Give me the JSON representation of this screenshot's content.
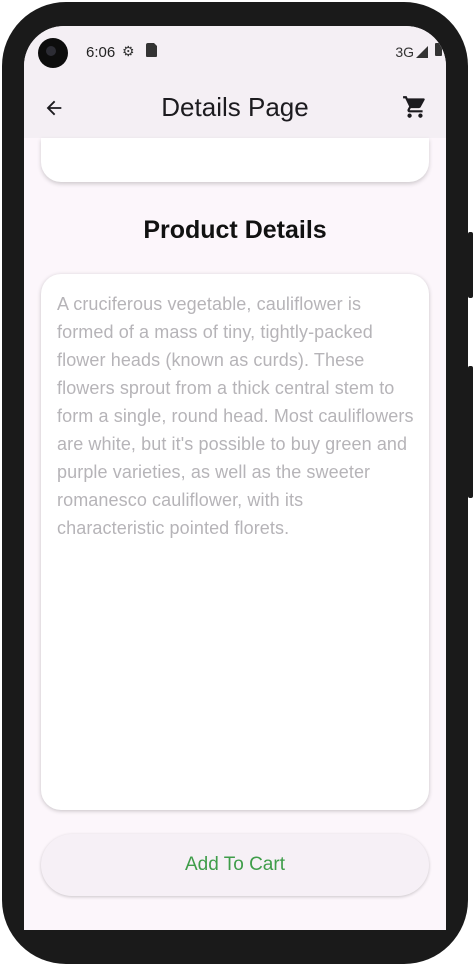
{
  "status_bar": {
    "time": "6:06",
    "network": "3G",
    "icons": [
      "settings-gear-icon",
      "sim-card-icon",
      "signal-icon",
      "battery-icon"
    ]
  },
  "app_bar": {
    "title": "Details Page",
    "back_icon": "arrow-back-icon",
    "cart_icon": "shopping-cart-icon"
  },
  "section": {
    "title": "Product Details"
  },
  "product": {
    "description": "A cruciferous vegetable, cauliflower is formed of a mass of tiny, tightly-packed flower heads (known as curds). These flowers sprout from a thick central stem to form a single, round head. Most cauliflowers are white, but it's possible to buy green and purple varieties, as well as the sweeter romanesco cauliflower, with its characteristic pointed florets."
  },
  "actions": {
    "add_to_cart_label": "Add To Cart"
  },
  "colors": {
    "accent_green": "#3f9d4a",
    "background": "#fcf6fb",
    "app_bar": "#f4eff4",
    "description_text": "#b6b4b8"
  }
}
